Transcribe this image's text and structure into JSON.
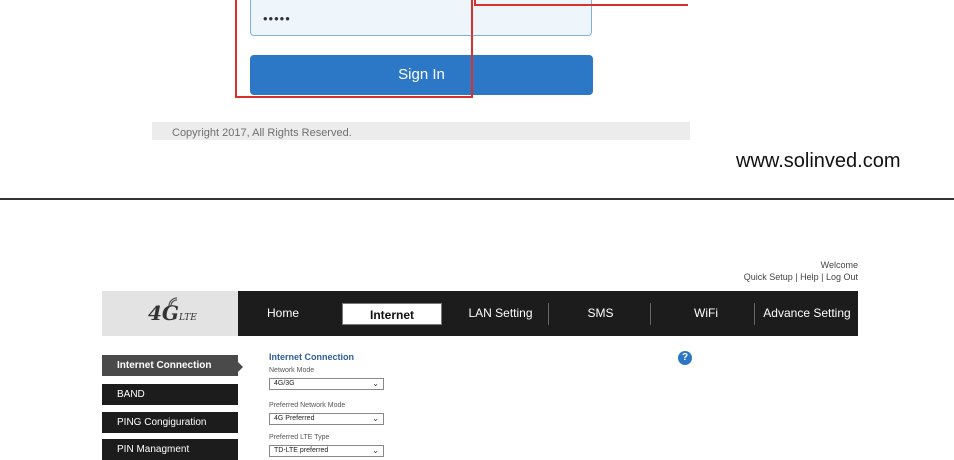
{
  "login": {
    "password_masked": "•••••",
    "signin_label": "Sign In",
    "copyright": "Copyright 2017, All Rights Reserved."
  },
  "watermark": "www.solinved.com",
  "router": {
    "welcome": "Welcome",
    "links": {
      "quick_setup": "Quick Setup",
      "sep1": " | ",
      "help": "Help",
      "sep2": " | ",
      "logout": "Log Out"
    },
    "logo_main": "4G",
    "logo_sub": "LTE",
    "nav": [
      "Home",
      "Internet",
      "LAN Setting",
      "SMS",
      "WiFi",
      "Advance Setting"
    ],
    "active_nav": "Internet",
    "sidebar": [
      "Internet Connection",
      "BAND",
      "PING Congiguration",
      "PIN Managment"
    ],
    "content": {
      "title": "Internet Connection",
      "fields": [
        {
          "label": "Network Mode",
          "value": "4G/3G"
        },
        {
          "label": "Preferred Network Mode",
          "value": "4G Preferred"
        },
        {
          "label": "Preferred LTE Type",
          "value": "TD-LTE preferred"
        }
      ],
      "help_icon": "?"
    }
  },
  "colors": {
    "accent_blue": "#2c78c6",
    "highlight_red": "#d9302c",
    "nav_dark": "#1c1c1c"
  }
}
